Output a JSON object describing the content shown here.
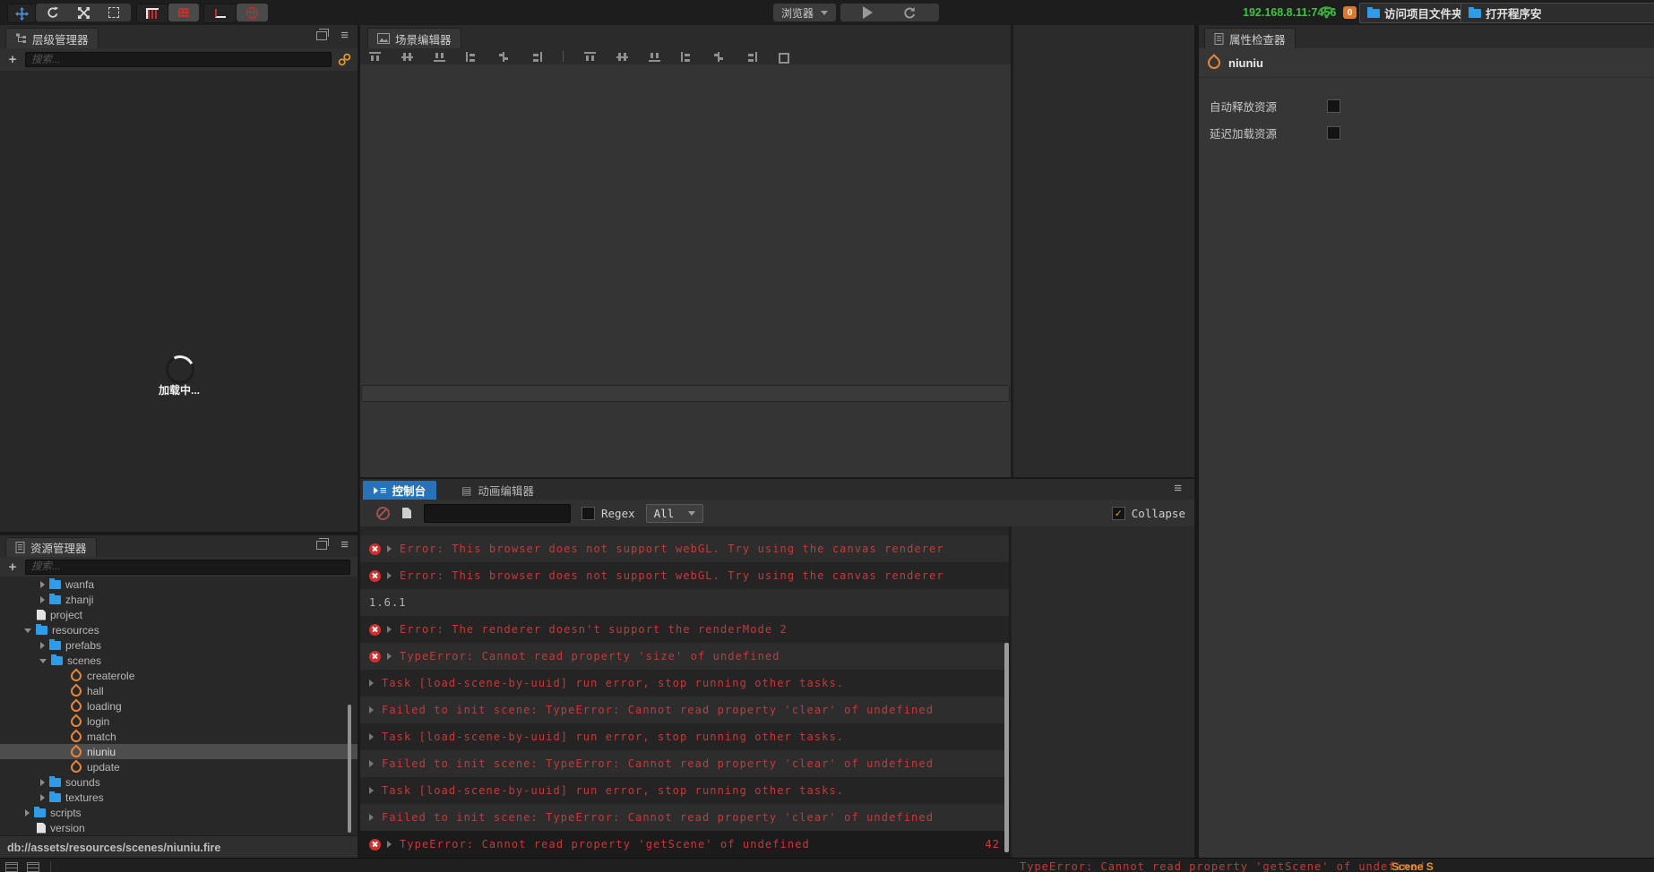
{
  "colors": {
    "tab_active_blue": "#2a72b8",
    "error_red": "#c23b3b",
    "folder_blue": "#2f9ce8",
    "fire_orange": "#e8853c",
    "badge_orange": "#e0782a",
    "ip_green": "#3ec43e",
    "collapse_check_orange": "#e8962e",
    "tool_move_blue": "#4a90d9"
  },
  "topbar": {
    "tool_icons": [
      "move-tool-icon",
      "rotate-tool-icon",
      "scale-tool-icon",
      "rect-tool-icon",
      "pivot-grid-icon",
      "snap-grid-icon",
      "corner-anchor-icon",
      "world-globe-icon"
    ],
    "browser_dropdown": "浏览器",
    "run_icons": [
      "play-icon",
      "refresh-icon"
    ],
    "ip_address": "192.168.8.11:7456",
    "wifi_icon": "wifi-icon",
    "notification_count": "0",
    "open_project_folder_button": "访问项目文件夹",
    "open_program_button": "打开程序安"
  },
  "hierarchy": {
    "title": "层级管理器",
    "search_placeholder": "搜索...",
    "loading_text": "加载中..."
  },
  "assets": {
    "title": "资源管理器",
    "search_placeholder": "搜索...",
    "status_path": "db://assets/resources/scenes/niuniu.fire",
    "tree": [
      {
        "label": "wanfa",
        "icon": "folder",
        "arrow": "r",
        "pad": 45
      },
      {
        "label": "zhanji",
        "icon": "folder",
        "arrow": "r",
        "pad": 45
      },
      {
        "label": "project",
        "icon": "file",
        "pad": 41
      },
      {
        "label": "resources",
        "icon": "folder",
        "arrow": "d",
        "pad": 27
      },
      {
        "label": "prefabs",
        "icon": "folder",
        "arrow": "r",
        "pad": 45
      },
      {
        "label": "scenes",
        "icon": "folder",
        "arrow": "d",
        "pad": 44
      },
      {
        "label": "createrole",
        "icon": "fire",
        "pad": 78
      },
      {
        "label": "hall",
        "icon": "fire",
        "pad": 78
      },
      {
        "label": "loading",
        "icon": "fire",
        "pad": 78
      },
      {
        "label": "login",
        "icon": "fire",
        "pad": 78
      },
      {
        "label": "match",
        "icon": "fire",
        "pad": 78
      },
      {
        "label": "niuniu",
        "icon": "fire",
        "pad": 78,
        "selected": true
      },
      {
        "label": "update",
        "icon": "fire",
        "pad": 78
      },
      {
        "label": "sounds",
        "icon": "folder",
        "arrow": "r",
        "pad": 45
      },
      {
        "label": "textures",
        "icon": "folder",
        "arrow": "r",
        "pad": 45
      },
      {
        "label": "scripts",
        "icon": "folder",
        "arrow": "r",
        "pad": 28
      },
      {
        "label": "version",
        "icon": "file",
        "pad": 41
      }
    ]
  },
  "scene": {
    "title": "场景编辑器",
    "align_icons": [
      {
        "name": "align-top-icon",
        "cls": "ai-t"
      },
      {
        "name": "align-vcenter-icon",
        "cls": "ai-vm"
      },
      {
        "name": "align-bottom-icon",
        "cls": "ai-b"
      },
      {
        "name": "align-left-icon",
        "cls": "ai-l"
      },
      {
        "name": "align-hcenter-icon",
        "cls": "ai-hm"
      },
      {
        "name": "align-right-icon",
        "cls": "ai-r"
      },
      {
        "divider": true
      },
      {
        "name": "distribute-top-icon",
        "cls": "ai-t"
      },
      {
        "name": "distribute-vcenter-icon",
        "cls": "ai-vm"
      },
      {
        "name": "distribute-bottom-icon",
        "cls": "ai-b"
      },
      {
        "name": "distribute-left-icon",
        "cls": "ai-l"
      },
      {
        "name": "distribute-hcenter-icon",
        "cls": "ai-hm"
      },
      {
        "name": "distribute-right-icon",
        "cls": "ai-r"
      },
      {
        "name": "same-size-icon",
        "cls": "ai-sz"
      }
    ]
  },
  "console": {
    "console_tab": "控制台",
    "animation_tab": "动画编辑器",
    "regex_label": "Regex",
    "filter_selected": "All",
    "collapse_label": "Collapse",
    "logs": [
      {
        "x": true,
        "arrow": true,
        "cls": "err",
        "text": "Error: This browser does not support webGL. Try using the canvas renderer"
      },
      {
        "x": true,
        "arrow": true,
        "cls": "err",
        "text": "Error: This browser does not support webGL. Try using the canvas renderer"
      },
      {
        "cls": "info",
        "text": "1.6.1"
      },
      {
        "x": true,
        "arrow": true,
        "cls": "err",
        "text": "Error: The renderer doesn't support the renderMode 2"
      },
      {
        "x": true,
        "arrow": true,
        "cls": "err",
        "text": "TypeError: Cannot read property 'size' of undefined"
      },
      {
        "arrow": true,
        "cls": "err",
        "text": "Task [load-scene-by-uuid] run error, stop running other tasks."
      },
      {
        "arrow": true,
        "cls": "err",
        "text": "Failed to init scene: TypeError: Cannot read property 'clear' of undefined"
      },
      {
        "arrow": true,
        "cls": "err",
        "text": "Task [load-scene-by-uuid] run error, stop running other tasks."
      },
      {
        "arrow": true,
        "cls": "err",
        "text": "Failed to init scene: TypeError: Cannot read property 'clear' of undefined"
      },
      {
        "arrow": true,
        "cls": "err",
        "text": "Task [load-scene-by-uuid] run error, stop running other tasks."
      },
      {
        "arrow": true,
        "cls": "err",
        "text": "Failed to init scene: TypeError: Cannot read property 'clear' of undefined"
      },
      {
        "x": true,
        "arrow": true,
        "cls": "err",
        "dark": true,
        "badge": "42",
        "text": "TypeError: Cannot read property 'getScene' of undefined"
      }
    ]
  },
  "inspector": {
    "title": "属性检查器",
    "node_name": "niuniu",
    "properties": [
      {
        "label": "自动释放资源",
        "checked": false
      },
      {
        "label": "延迟加载资源",
        "checked": false
      }
    ]
  },
  "bottombar": {
    "error_text": "TypeError: Cannot read property 'getScene' of undefined",
    "scene_label": "Scene S"
  }
}
